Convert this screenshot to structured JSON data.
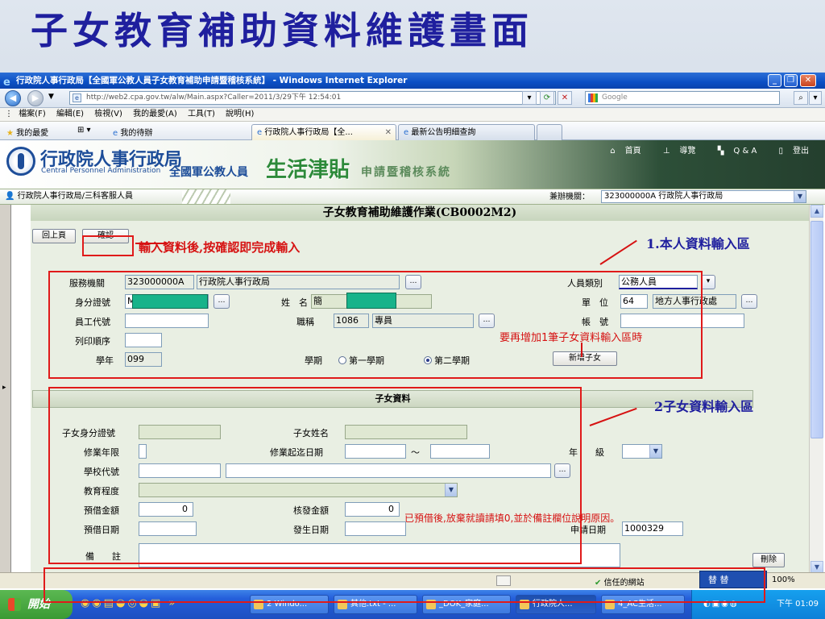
{
  "slide": {
    "title": "子女教育補助資料維護畫面"
  },
  "window": {
    "title": "行政院人事行政局【全國軍公教人員子女教育補助申請暨稽核系統】 - Windows Internet Explorer",
    "url": "http://web2.cpa.gov.tw/alw/Main.aspx?Caller=2011/3/29下午 12:54:01",
    "search_placeholder": "Google",
    "menu": [
      "檔案(F)",
      "編輯(E)",
      "檢視(V)",
      "我的最愛(A)",
      "工具(T)",
      "說明(H)"
    ],
    "favorites_label": "我的最愛",
    "fav_link": "我的待辦",
    "tabs": [
      {
        "label": "行政院人事行政局【全..."
      },
      {
        "label": "最新公告明細查詢"
      }
    ]
  },
  "banner": {
    "org_name": "行政院人事行政局",
    "org_en": "Central Personnel Administration",
    "sys_part1": "全國軍公教人員",
    "sys_part2": "生活津貼",
    "sys_part3": "申請暨稽核系統",
    "links": [
      "首頁",
      "導覽",
      "Q & A",
      "登出"
    ]
  },
  "orgbar": {
    "user": "行政院人事行政局/三科客服人員",
    "org_label": "兼辦機關：",
    "org_value": "323000000A 行政院人事行政局"
  },
  "form": {
    "title": "子女教育補助維護作業(CB0002M2)",
    "back_button": "回上頁",
    "confirm_button": "確認",
    "agency_label": "服務機關",
    "agency_code": "323000000A",
    "agency_name": "行政院人事行政局",
    "staff_type_label": "人員類別",
    "staff_type_value": "公務人員",
    "id_label": "身分證號",
    "id_value": "M",
    "name_label": "姓　名",
    "name_value": "簡",
    "unit_label": "單　位",
    "unit_code": "64",
    "unit_name": "地方人事行政處",
    "emp_label": "員工代號",
    "title_label": "職稱",
    "title_code": "1086",
    "title_name": "專員",
    "account_label": "帳　號",
    "print_label": "列印順序",
    "year_label": "學年",
    "year_value": "099",
    "term_label": "學期",
    "term1": "第一學期",
    "term2": "第二學期",
    "add_child_button": "新增子女"
  },
  "child": {
    "section_title": "子女資料",
    "child_id_label": "子女身分證號",
    "child_name_label": "子女姓名",
    "duration_label": "修業年限",
    "period_label": "修業起迄日期",
    "tilde": "～",
    "grade_label": "年　　級",
    "school_label": "學校代號",
    "edu_label": "教育程度",
    "advance_amt_label": "預借金額",
    "advance_amt": "0",
    "approved_amt_label": "核發金額",
    "approved_amt": "0",
    "advance_date_label": "預借日期",
    "issue_date_label": "發生日期",
    "apply_date_label": "申請日期",
    "apply_date": "1000329",
    "remark_label": "備　　註",
    "delete_button": "刪除"
  },
  "annotations": {
    "confirm_note": "輸入資料後,按確認即完成輸入",
    "area1": "1.本人資料輸入區",
    "area2": "2子女資料輸入區",
    "add_note": "要再增加1筆子女資料輸入區時",
    "advance_note": "已預借後,放棄就讀請填0,並於備註欄位說明原因。"
  },
  "statusbar": {
    "zone": "信任的網站",
    "zoom": "100%"
  },
  "taskbar": {
    "start": "開始",
    "buttons": [
      "2 Windo...",
      "其他.txt - ...",
      "_DOK_家庭...",
      "行政院人...",
      "4_AC生活..."
    ],
    "ime": "替 替",
    "clock": "下午 01:09"
  }
}
